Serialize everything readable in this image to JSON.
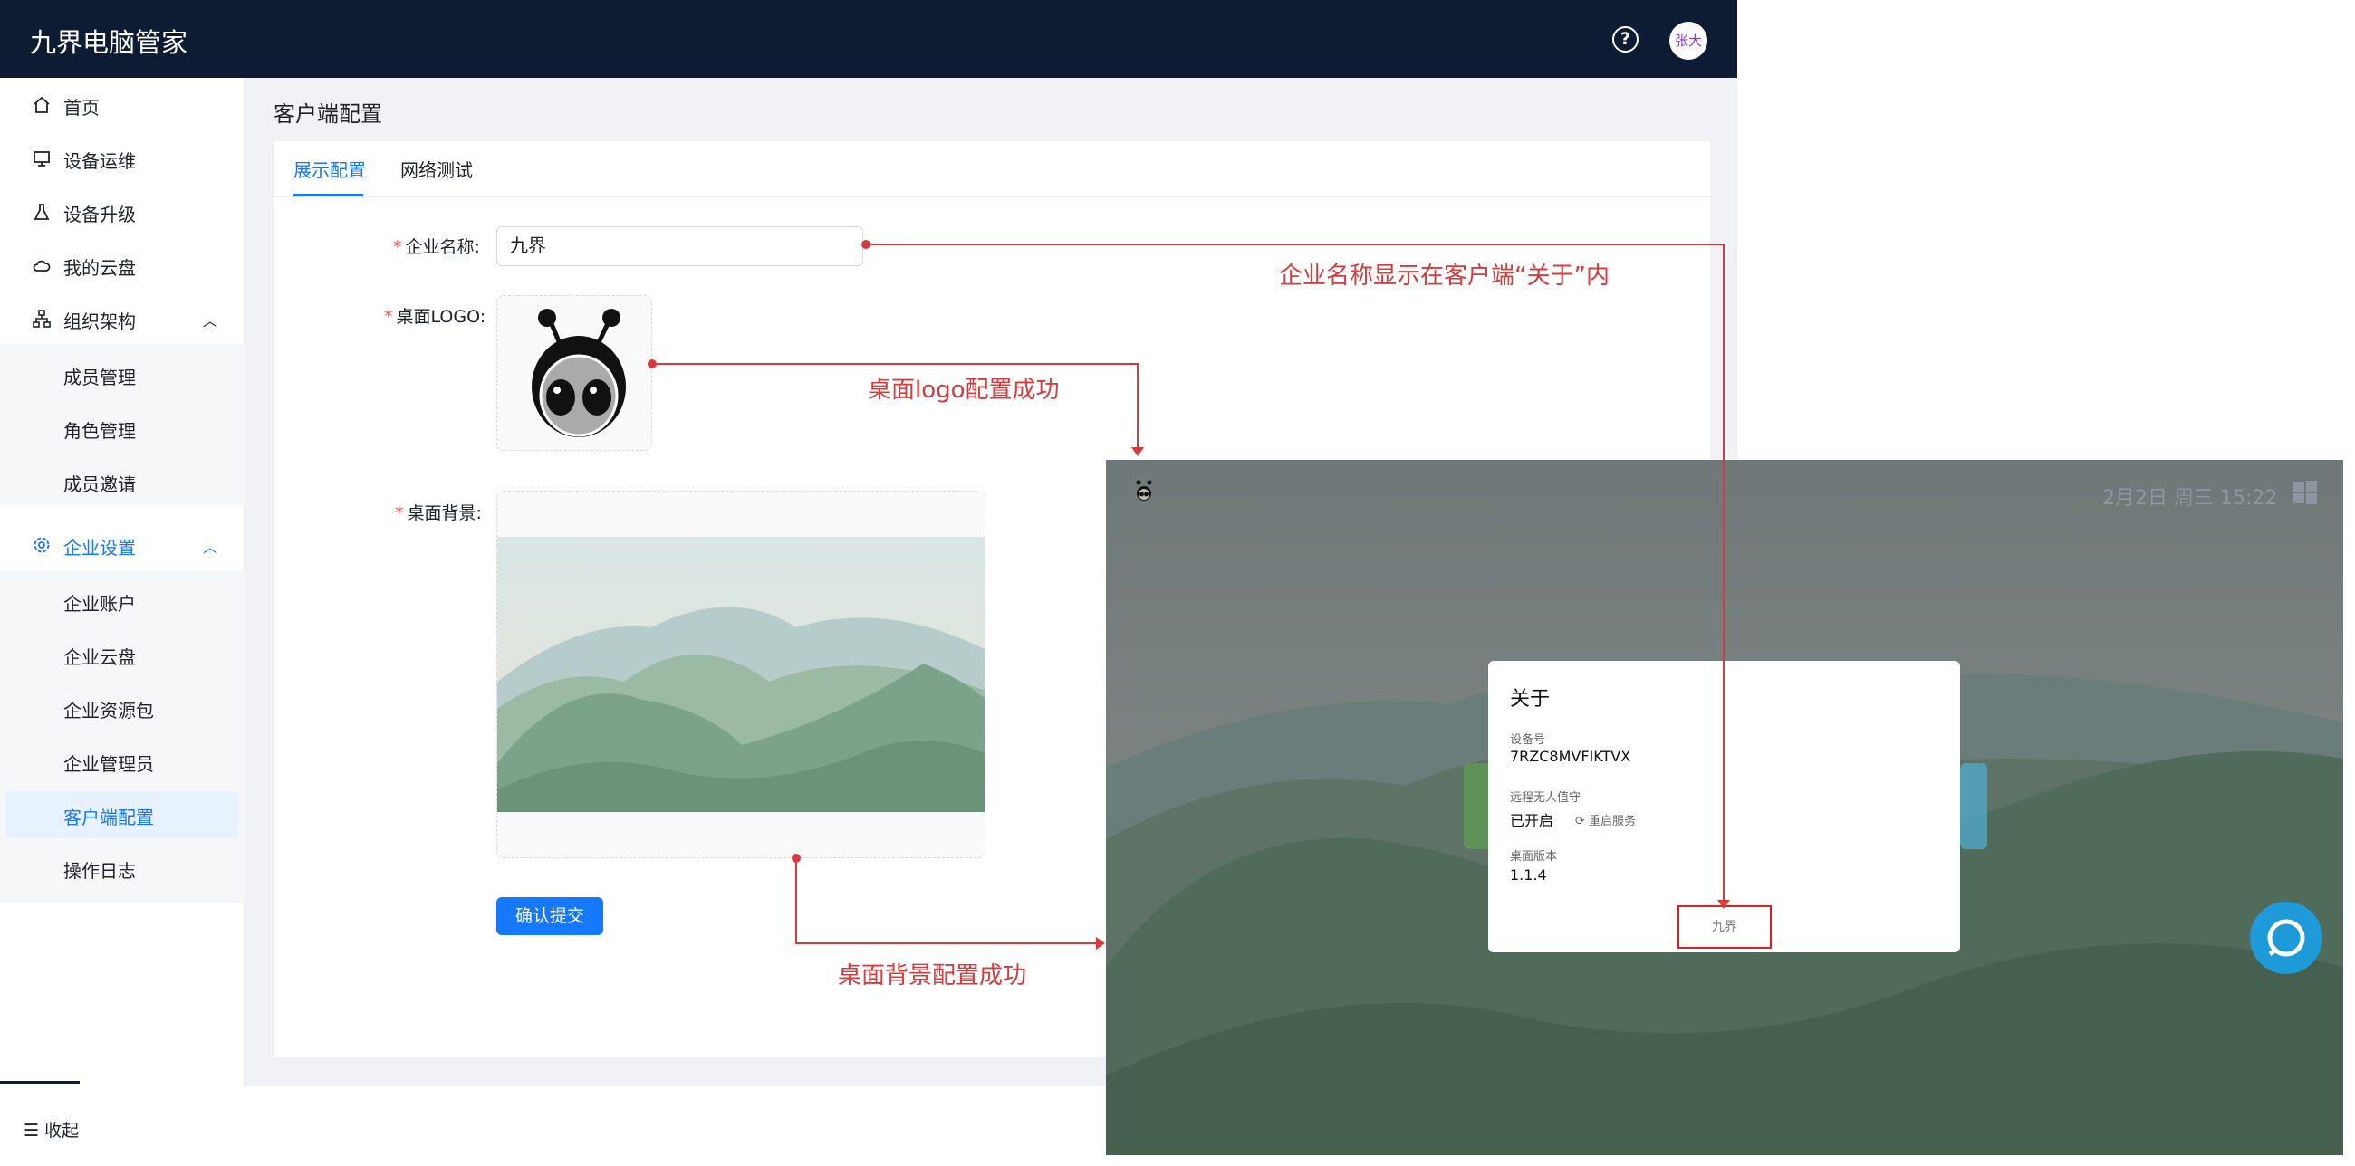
{
  "app": {
    "title": "九界电脑管家",
    "user_avatar_text": "张大",
    "help_icon": "question-circle-icon"
  },
  "sidebar": {
    "items": [
      {
        "label": "首页",
        "icon": "home-icon"
      },
      {
        "label": "设备运维",
        "icon": "monitor-icon"
      },
      {
        "label": "设备升级",
        "icon": "flask-icon"
      },
      {
        "label": "我的云盘",
        "icon": "cloud-icon"
      },
      {
        "label": "组织架构",
        "icon": "org-chart-icon",
        "expanded": true
      },
      {
        "label": "企业设置",
        "icon": "gear-icon",
        "expanded": true,
        "active": true
      }
    ],
    "org_children": [
      "成员管理",
      "角色管理",
      "成员邀请"
    ],
    "enterprise_children": [
      "企业账户",
      "企业云盘",
      "企业资源包",
      "企业管理员",
      "客户端配置",
      "操作日志"
    ],
    "active_child": "客户端配置",
    "collapse_label": "收起"
  },
  "main": {
    "page_title": "客户端配置",
    "tabs": [
      {
        "label": "展示配置",
        "active": true
      },
      {
        "label": "网络测试",
        "active": false
      }
    ],
    "form": {
      "company_name_label": "企业名称:",
      "company_name_value": "九界",
      "logo_label": "桌面LOGO:",
      "background_label": "桌面背景:",
      "submit_label": "确认提交",
      "required_mark": "*"
    }
  },
  "desktop_preview": {
    "clock": "2月2日 周三 15:22",
    "about_dialog": {
      "title": "关于",
      "device_id_label": "设备号",
      "device_id": "7RZC8MVFIKTVX",
      "remote_label": "远程无人值守",
      "remote_value": "已开启",
      "restart_label": "重启服务",
      "version_label": "桌面版本",
      "version": "1.1.4",
      "company_name": "九界"
    }
  },
  "annotations": {
    "name_note": "企业名称显示在客户端“关于”内",
    "logo_note": "桌面logo配置成功",
    "background_note": "桌面背景配置成功"
  },
  "colors": {
    "topbar": "#0d1b33",
    "primary": "#1677ff",
    "annotation": "#d83b3b"
  }
}
